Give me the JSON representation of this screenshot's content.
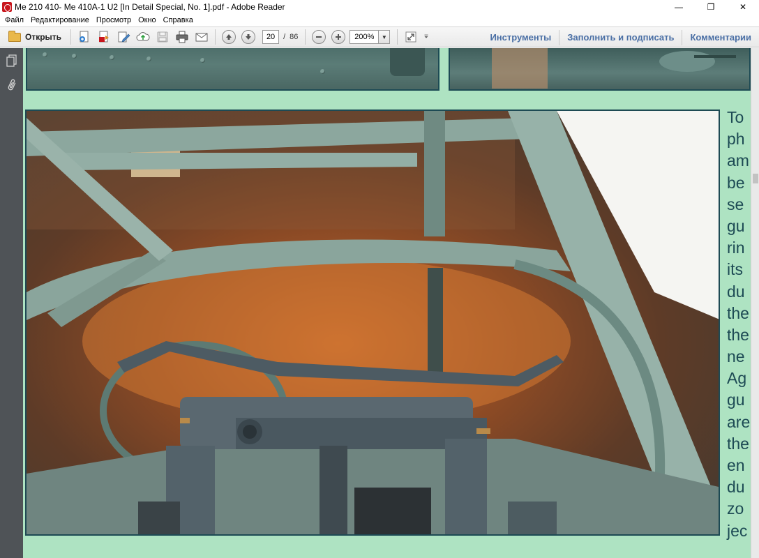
{
  "window": {
    "title": "Me 210  410- Me 410A-1  U2 [In Detail Special, No. 1].pdf - Adobe Reader",
    "controls": {
      "minimize": "—",
      "restore": "❐",
      "close": "✕"
    }
  },
  "menu": {
    "items": [
      "Файл",
      "Редактирование",
      "Просмотр",
      "Окно",
      "Справка"
    ]
  },
  "toolbar": {
    "open_label": "Открыть",
    "page_current": "20",
    "page_separator": "/",
    "page_total": "86",
    "zoom_value": "200%",
    "tools_label": "Инструменты",
    "fill_sign_label": "Заполнить и подписать",
    "comments_label": "Комментарии"
  },
  "icons": {
    "open": "folder-icon",
    "create": "create-pdf-icon",
    "export": "export-pdf-icon",
    "edit": "edit-icon",
    "cloud": "cloud-upload-icon",
    "save": "save-icon",
    "print": "print-icon",
    "email": "email-icon",
    "prev": "arrow-up-icon",
    "next": "arrow-down-icon",
    "zoom_out": "minus-icon",
    "zoom_in": "plus-icon",
    "fit": "fit-page-icon",
    "customize": "chevron-down-icon",
    "pages_panel": "pages-icon",
    "attachments_panel": "paperclip-icon"
  },
  "document": {
    "side_text_lines": [
      "To",
      "ph",
      "am",
      "be",
      "se",
      "gu",
      "rin",
      "its",
      "du",
      "the",
      "the",
      "ne",
      "Ag",
      "gu",
      "are",
      "the",
      "en",
      "du",
      "zo",
      "jec"
    ]
  },
  "colors": {
    "page_background": "#aee3c2",
    "text_accent": "#1d4a54",
    "link_blue": "#4a6fa5",
    "nav_pane": "#4f5357"
  }
}
